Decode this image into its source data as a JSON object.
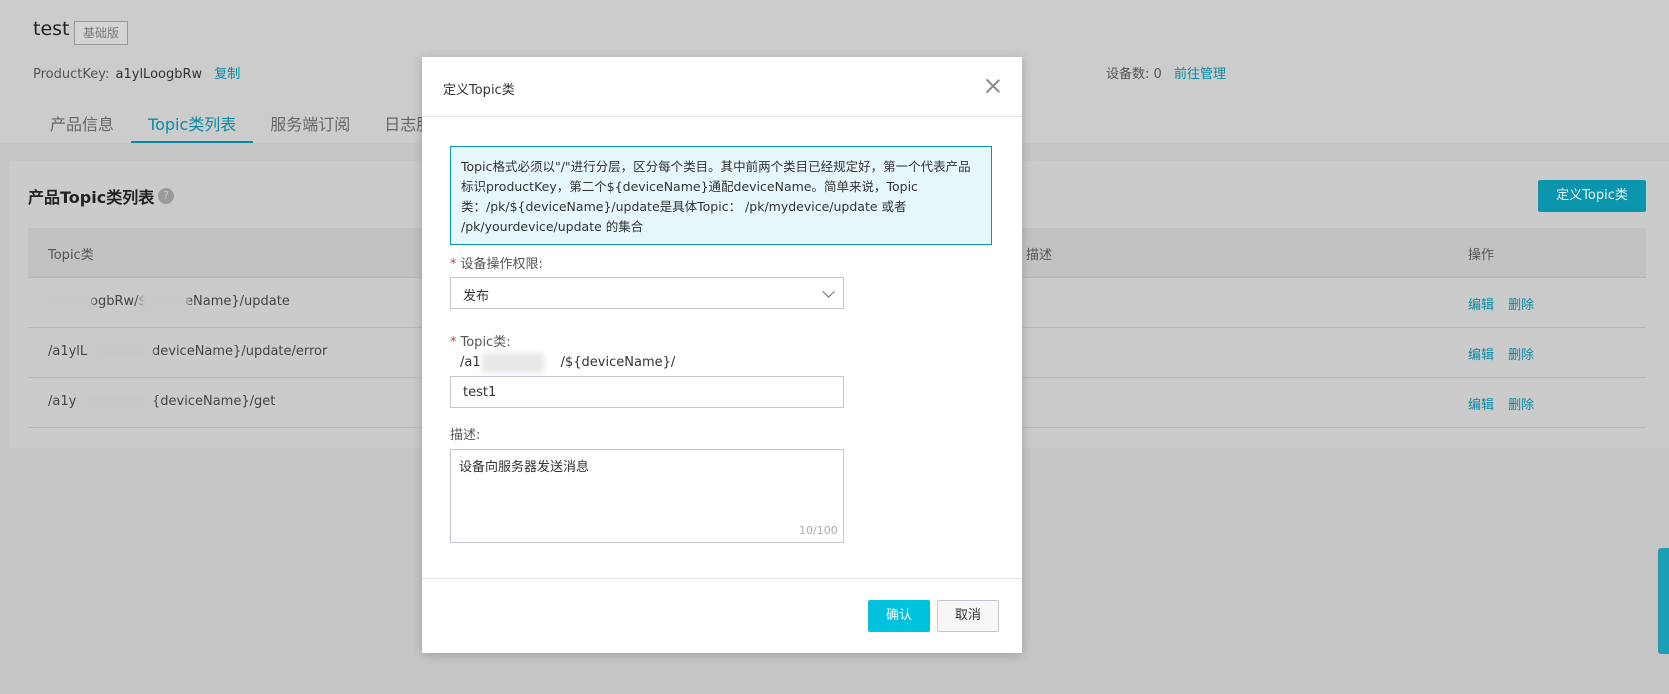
{
  "header": {
    "title": "test",
    "edition_badge": "基础版",
    "product_key_label": "ProductKey:",
    "product_key_value": "a1ylLoogbRw",
    "copy_label": "复制",
    "device_count_label": "设备数:",
    "device_count_value": "0",
    "manage_link": "前往管理"
  },
  "tabs": [
    {
      "label": "产品信息",
      "active": false
    },
    {
      "label": "Topic类列表",
      "active": true
    },
    {
      "label": "服务端订阅",
      "active": false
    },
    {
      "label": "日志服",
      "active": false
    }
  ],
  "section": {
    "title": "产品Topic类列表",
    "help_icon": "question-circle-icon",
    "define_button": "定义Topic类"
  },
  "table": {
    "columns": [
      "Topic类",
      "描述",
      "操作"
    ],
    "rows": [
      {
        "topic": "ogbRw/$[blurred]eName}/update",
        "actions": [
          "编辑",
          "删除"
        ]
      },
      {
        "topic": "/a1ylL[blurred]deviceName}/update/error",
        "actions": [
          "编辑",
          "删除"
        ]
      },
      {
        "topic": "/a1y[blurred]{deviceName}/get",
        "actions": [
          "编辑",
          "删除"
        ]
      }
    ],
    "row_texts": [
      "ogbRw/$",
      "eName}/update",
      "/a1ylL",
      "deviceName}/update/error",
      "/a1y",
      "{deviceName}/get"
    ]
  },
  "modal": {
    "title": "定义Topic类",
    "notice": "Topic格式必须以\"/\"进行分层，区分每个类目。其中前两个类目已经规定好，第一个代表产品标识productKey，第二个${deviceName}通配deviceName。简单来说，Topic类：/pk/${deviceName}/update是具体Topic： /pk/mydevice/update 或者 /pk/yourdevice/update 的集合",
    "permission_label": "设备操作权限:",
    "permission_value": "发布",
    "topic_label": "Topic类:",
    "topic_prefix_start": "/a1",
    "topic_prefix_end": "/${deviceName}/",
    "topic_value": "test1",
    "desc_label": "描述:",
    "desc_value": "设备向服务器发送消息",
    "char_count": "10/100",
    "confirm_label": "确认",
    "cancel_label": "取消"
  },
  "colors": {
    "accent": "#00c1de",
    "link": "#0a8aa6",
    "required": "#d9363e"
  }
}
